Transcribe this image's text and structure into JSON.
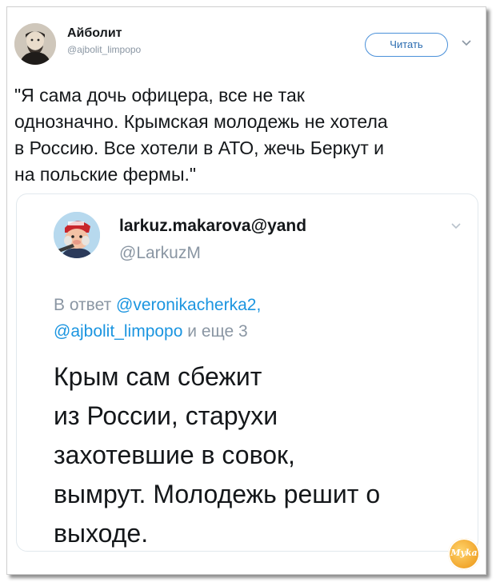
{
  "tweet": {
    "author_name": "Айболит",
    "author_handle": "@ajbolit_limpopo",
    "follow_label": "Читать",
    "text": "\"Я сама дочь офицера, все не так\nоднозначно. Крымская молодежь не хотела\nв Россию. Все хотели в АТО, жечь Беркут и\nна польские фермы.\""
  },
  "quoted_tweet": {
    "author_name": "larkuz.makarova@yand",
    "author_handle": "@LarkuzM",
    "reply_prefix": "В ответ ",
    "reply_mention_1": "@veronikacherka2,",
    "reply_mention_2": "@ajbolit_limpopo",
    "reply_suffix": " и еще 3",
    "text": "Крым сам сбежит\nиз России, старухи\nзахотевшие в совок,\nвымрут. Молодежь решит о\nвыходе."
  },
  "watermark_text": "Myka",
  "icons": [
    "chevron-down-icon",
    "avatar"
  ]
}
